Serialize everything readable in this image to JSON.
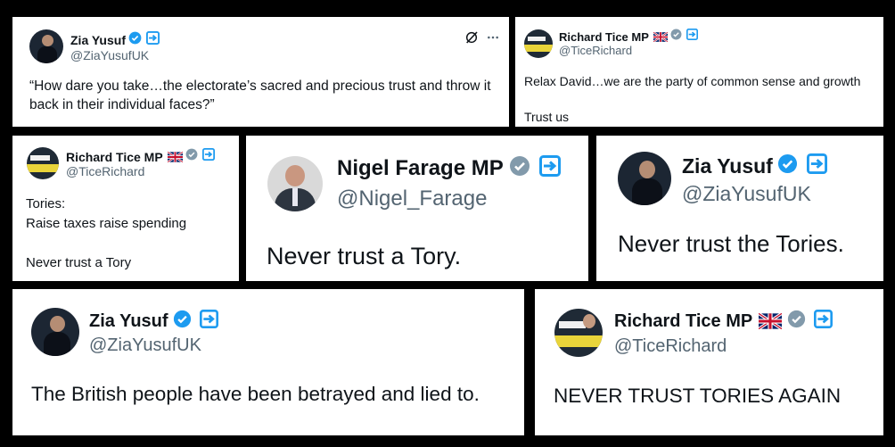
{
  "accounts": {
    "zia": {
      "name": "Zia Yusuf",
      "handle": "@ZiaYusufUK"
    },
    "tice": {
      "name": "Richard Tice MP",
      "handle": "@TiceRichard"
    },
    "farage": {
      "name": "Nigel Farage MP",
      "handle": "@Nigel_Farage"
    }
  },
  "colors": {
    "verified_blue": "#1d9bf0",
    "verified_grey": "#829aab",
    "handle": "#536471",
    "text": "#0f1419",
    "background": "#000000"
  },
  "icons": {
    "verified": "verified-badge-icon",
    "affiliate": "square-arrow-badge-icon",
    "flag": "uk-flag-icon",
    "grok": "grok-icon",
    "more": "more-dots-icon"
  },
  "avatar_text": {
    "tice": "THE WHOLE TELLS TICE... WE'RE SORRY"
  },
  "tweets": [
    {
      "text": "“How dare you take…the electorate’s sacred and precious trust and throw it back in their individual faces?”"
    },
    {
      "text": "Relax David…we are the party of common sense and growth\n\nTrust us"
    },
    {
      "text": "Tories:\nRaise taxes raise spending\n\nNever trust a Tory"
    },
    {
      "text": "Never trust a Tory."
    },
    {
      "text": "Never trust the Tories."
    },
    {
      "text": "The British people have been betrayed and lied to."
    },
    {
      "text": "NEVER TRUST TORIES AGAIN"
    }
  ]
}
